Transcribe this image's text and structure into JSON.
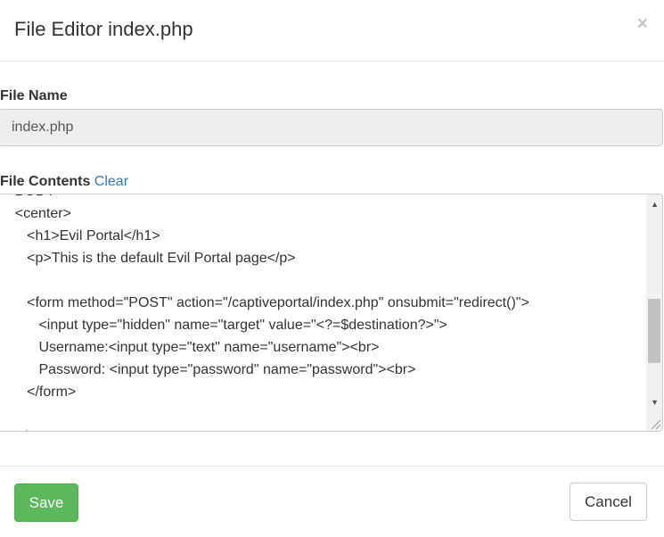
{
  "modal": {
    "title": "File Editor index.php",
    "close_symbol": "×"
  },
  "file_name": {
    "label": "File Name",
    "value": "index.php"
  },
  "file_contents": {
    "label": "File Contents",
    "clear_label": "Clear",
    "lines": [
      "    BODY",
      "    <center>",
      "       <h1>Evil Portal</h1>",
      "       <p>This is the default Evil Portal page</p>",
      "",
      "       <form method=\"POST\" action=\"/captiveportal/index.php\" onsubmit=\"redirect()\">",
      "          <input type=\"hidden\" name=\"target\" value=\"<?=$destination?>\">",
      "          Username:<input type=\"text\" name=\"username\"><br>",
      "          Password: <input type=\"password\" name=\"password\"><br>",
      "       </form>",
      "",
      "    </center>"
    ]
  },
  "footer": {
    "save_label": "Save",
    "cancel_label": "Cancel"
  },
  "icons": {
    "close": "close-icon",
    "scroll_up": "scroll-up-arrow-icon",
    "scroll_down": "scroll-down-arrow-icon",
    "resize": "resize-grip-icon"
  },
  "colors": {
    "save_button": "#5cb85c",
    "link": "#337ab7",
    "readonly_input_bg": "#eeeeee"
  }
}
